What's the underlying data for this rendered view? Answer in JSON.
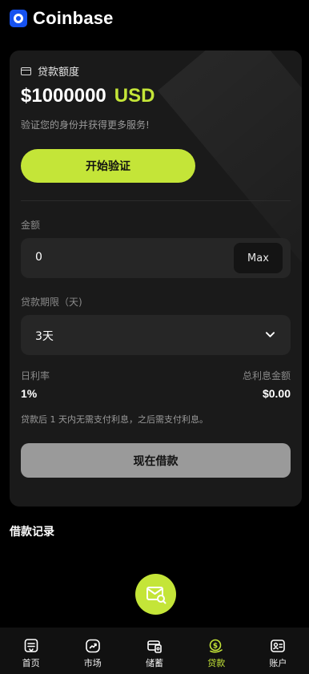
{
  "app": {
    "brand": "Coinbase"
  },
  "loan_card": {
    "quota_label": "贷款额度",
    "amount": "$1000000",
    "currency": "USD",
    "verify_hint": "验证您的身份并获得更多服务!",
    "verify_button": "开始验证",
    "amount_label": "金额",
    "amount_value": "0",
    "max_button": "Max",
    "term_label": "贷款期限（天)",
    "term_value": "3天",
    "daily_rate_label": "日利率",
    "daily_rate_value": "1%",
    "total_interest_label": "总利息金额",
    "total_interest_value": "$0.00",
    "note": "贷款后 1 天内无需支付利息，之后需支付利息。",
    "borrow_button": "现在借款"
  },
  "records": {
    "title": "借款记录"
  },
  "tabbar": {
    "items": [
      {
        "label": "首页",
        "icon": "home-icon"
      },
      {
        "label": "市场",
        "icon": "market-icon"
      },
      {
        "label": "储蓄",
        "icon": "savings-icon"
      },
      {
        "label": "贷款",
        "icon": "loan-icon"
      },
      {
        "label": "账户",
        "icon": "account-icon"
      }
    ],
    "active": "贷款"
  },
  "colors": {
    "accent": "#c4e538",
    "brand": "#1652f0",
    "background": "#000000",
    "card": "#1a1a1a"
  }
}
